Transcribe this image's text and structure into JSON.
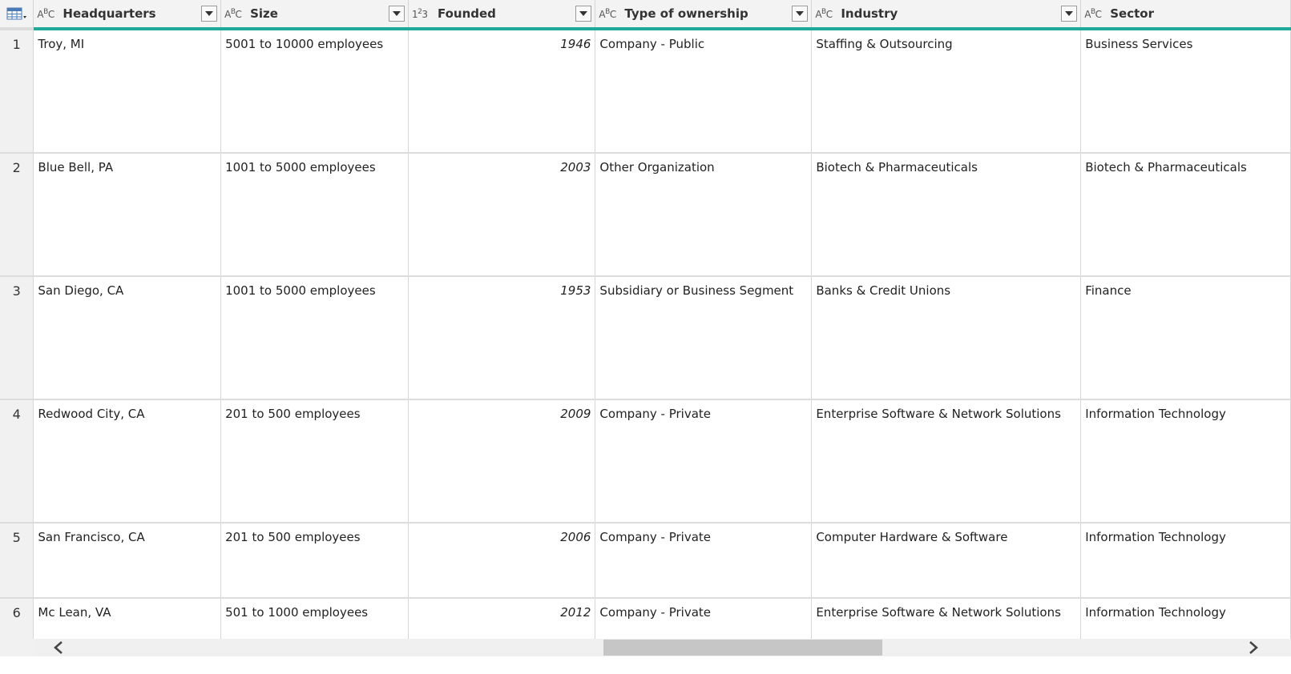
{
  "columns": [
    {
      "type_icon": "ABC",
      "label": "Headquarters"
    },
    {
      "type_icon": "123",
      "label": "Size"
    },
    {
      "type_icon": "123",
      "label": "Founded"
    },
    {
      "type_icon": "ABC",
      "label": "Type of ownership"
    },
    {
      "type_icon": "ABC",
      "label": "Industry"
    },
    {
      "type_icon": "ABC",
      "label": "Sector"
    }
  ],
  "type_icons": {
    "text": "ABC",
    "number": "123"
  },
  "rows": [
    {
      "index": "1",
      "headquarters": "Troy, MI",
      "size": "5001 to 10000 employees",
      "founded": "1946",
      "ownership": "Company - Public",
      "industry": "Staffing & Outsourcing",
      "sector": "Business Services"
    },
    {
      "index": "2",
      "headquarters": "Blue Bell, PA",
      "size": "1001 to 5000 employees",
      "founded": "2003",
      "ownership": "Other Organization",
      "industry": "Biotech & Pharmaceuticals",
      "sector": "Biotech & Pharmaceuticals"
    },
    {
      "index": "3",
      "headquarters": "San Diego, CA",
      "size": "1001 to 5000 employees",
      "founded": "1953",
      "ownership": "Subsidiary or Business Segment",
      "industry": "Banks & Credit Unions",
      "sector": "Finance"
    },
    {
      "index": "4",
      "headquarters": "Redwood City, CA",
      "size": "201 to 500 employees",
      "founded": "2009",
      "ownership": "Company - Private",
      "industry": "Enterprise Software & Network Solutions",
      "sector": "Information Technology"
    },
    {
      "index": "5",
      "headquarters": "San Francisco, CA",
      "size": "201 to 500 employees",
      "founded": "2006",
      "ownership": "Company - Private",
      "industry": "Computer Hardware & Software",
      "sector": "Information Technology"
    },
    {
      "index": "6",
      "headquarters": "Mc Lean, VA",
      "size": "501 to 1000 employees",
      "founded": "2012",
      "ownership": "Company - Private",
      "industry": "Enterprise Software & Network Solutions",
      "sector": "Information Technology"
    }
  ],
  "colors": {
    "accent": "#1ea99b",
    "header_bg": "#f3f3f3",
    "scroll_thumb": "#c6c6c6"
  },
  "icons": {
    "table_menu": "table-icon",
    "column_dropdown": "chevron-down-icon",
    "scroll_left": "chevron-left-icon",
    "scroll_right": "chevron-right-icon"
  }
}
